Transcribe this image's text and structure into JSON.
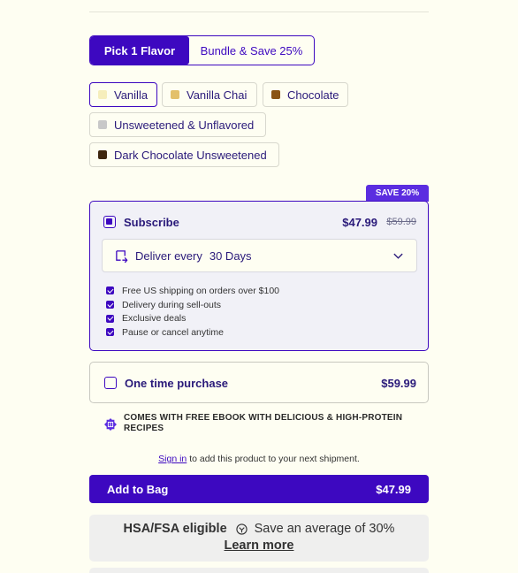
{
  "toggle": {
    "active_label": "Pick 1 Flavor",
    "inactive_label": "Bundle & Save 25%"
  },
  "flavors": [
    {
      "label": "Vanilla",
      "color": "#f6eebb",
      "selected": true
    },
    {
      "label": "Vanilla Chai",
      "color": "#e3c06a",
      "selected": false
    },
    {
      "label": "Chocolate",
      "color": "#8a5315",
      "selected": false
    },
    {
      "label": "Unsweetened & Unflavored",
      "color": "#c8c8c8",
      "selected": false
    },
    {
      "label": "Dark Chocolate Unsweetened",
      "color": "#3e260e",
      "selected": false
    }
  ],
  "subscribe": {
    "badge": "SAVE 20%",
    "title": "Subscribe",
    "price": "$47.99",
    "old_price": "$59.99",
    "deliver_label": "Deliver every",
    "deliver_value": "30 Days",
    "perks": [
      "Free US shipping on orders over $100",
      "Delivery during sell-outs",
      "Exclusive deals",
      "Pause or cancel anytime"
    ]
  },
  "one_time": {
    "title": "One time purchase",
    "price": "$59.99"
  },
  "ebook_text": "COMES WITH FREE EBOOK WITH DELICIOUS & HIGH-PROTEIN RECIPES",
  "signin": {
    "link": "Sign in",
    "rest": " to add this product to your next shipment."
  },
  "add_to_bag": {
    "label": "Add to Bag",
    "price": "$47.99"
  },
  "hsa": {
    "title": "HSA/FSA eligible",
    "savings": "Save an average of 30%",
    "learn": "Learn more"
  },
  "colors": {
    "accent": "#3d08c0",
    "badge": "#5b2de0",
    "text": "#2a1a7a",
    "background": "#fefef2"
  }
}
